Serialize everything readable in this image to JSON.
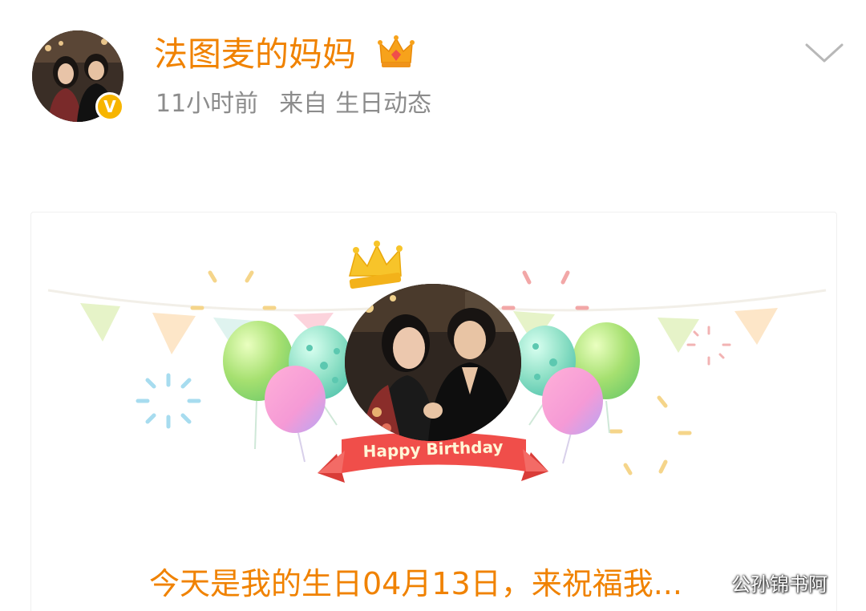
{
  "post": {
    "author_name": "法图麦的妈妈",
    "time_ago": "11小时前",
    "source_prefix": "来自",
    "source_name": "生日动态"
  },
  "icons": {
    "author_badge": "crown-icon",
    "verified": "verified-badge-icon",
    "more": "chevron-down-icon"
  },
  "verified_badge_letter": "V",
  "birthday_card": {
    "ribbon_text": "Happy Birthday",
    "message": "今天是我的生日04月13日，来祝福我..."
  },
  "watermark": "公孙锦书阿",
  "colors": {
    "accent_orange": "#f08200",
    "meta_gray": "#8c8c8c",
    "verified_yellow": "#f7b500",
    "ribbon_red": "#f04e4a"
  }
}
